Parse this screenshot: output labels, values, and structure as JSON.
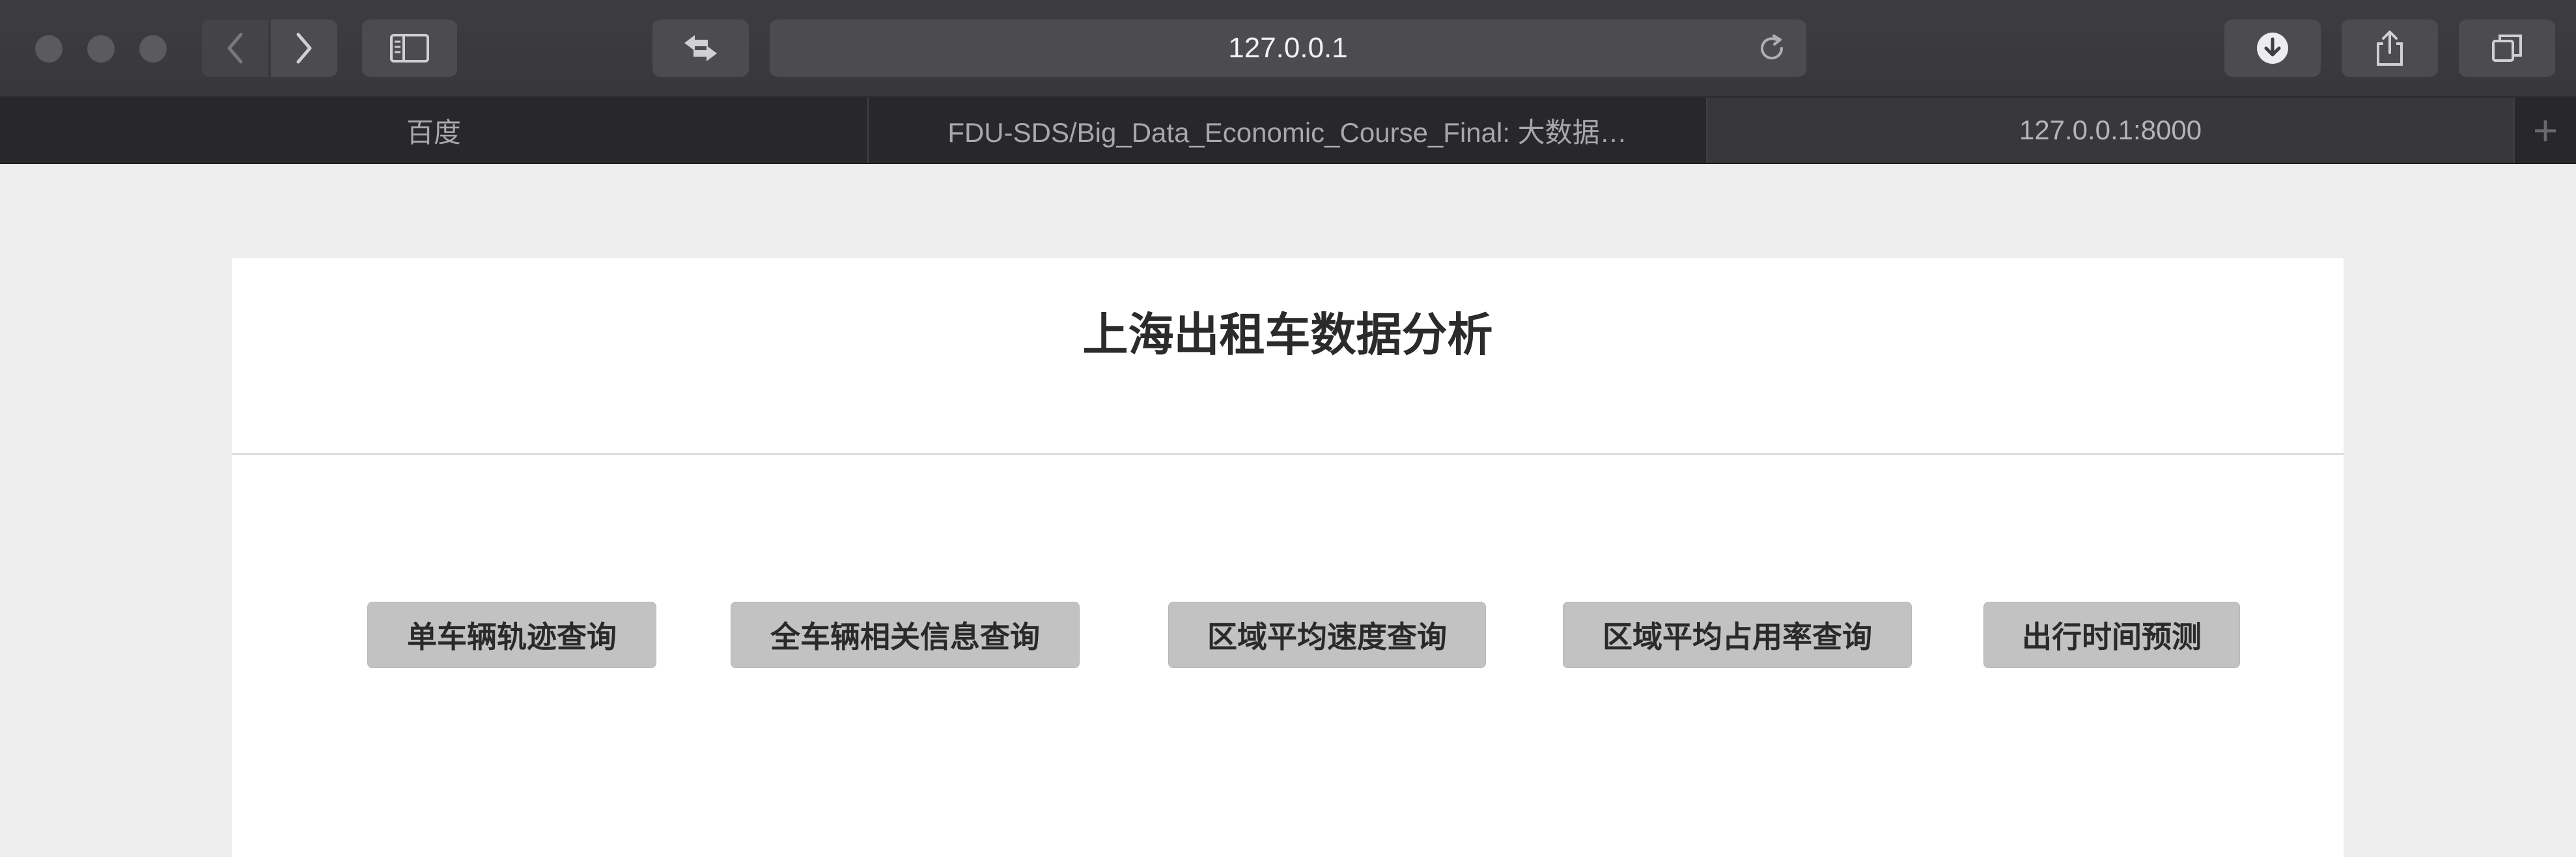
{
  "browser": {
    "address_url": "127.0.0.1",
    "tabs": [
      {
        "label": "百度",
        "active": false
      },
      {
        "label": "FDU-SDS/Big_Data_Economic_Course_Final: 大数据…",
        "active": false
      },
      {
        "label": "127.0.0.1:8000",
        "active": true
      }
    ],
    "new_tab_label": "+",
    "icons": [
      "back-icon",
      "forward-icon",
      "sidebar-icon",
      "swap-icon",
      "reload-icon",
      "download-icon",
      "share-icon",
      "tabs-overview-icon"
    ]
  },
  "page": {
    "title": "上海出租车数据分析",
    "buttons": [
      {
        "label": "单车辆轨迹查询"
      },
      {
        "label": "全车辆相关信息查询"
      },
      {
        "label": "区域平均速度查询"
      },
      {
        "label": "区域平均占用率查询"
      },
      {
        "label": "出行时间预测"
      }
    ]
  }
}
